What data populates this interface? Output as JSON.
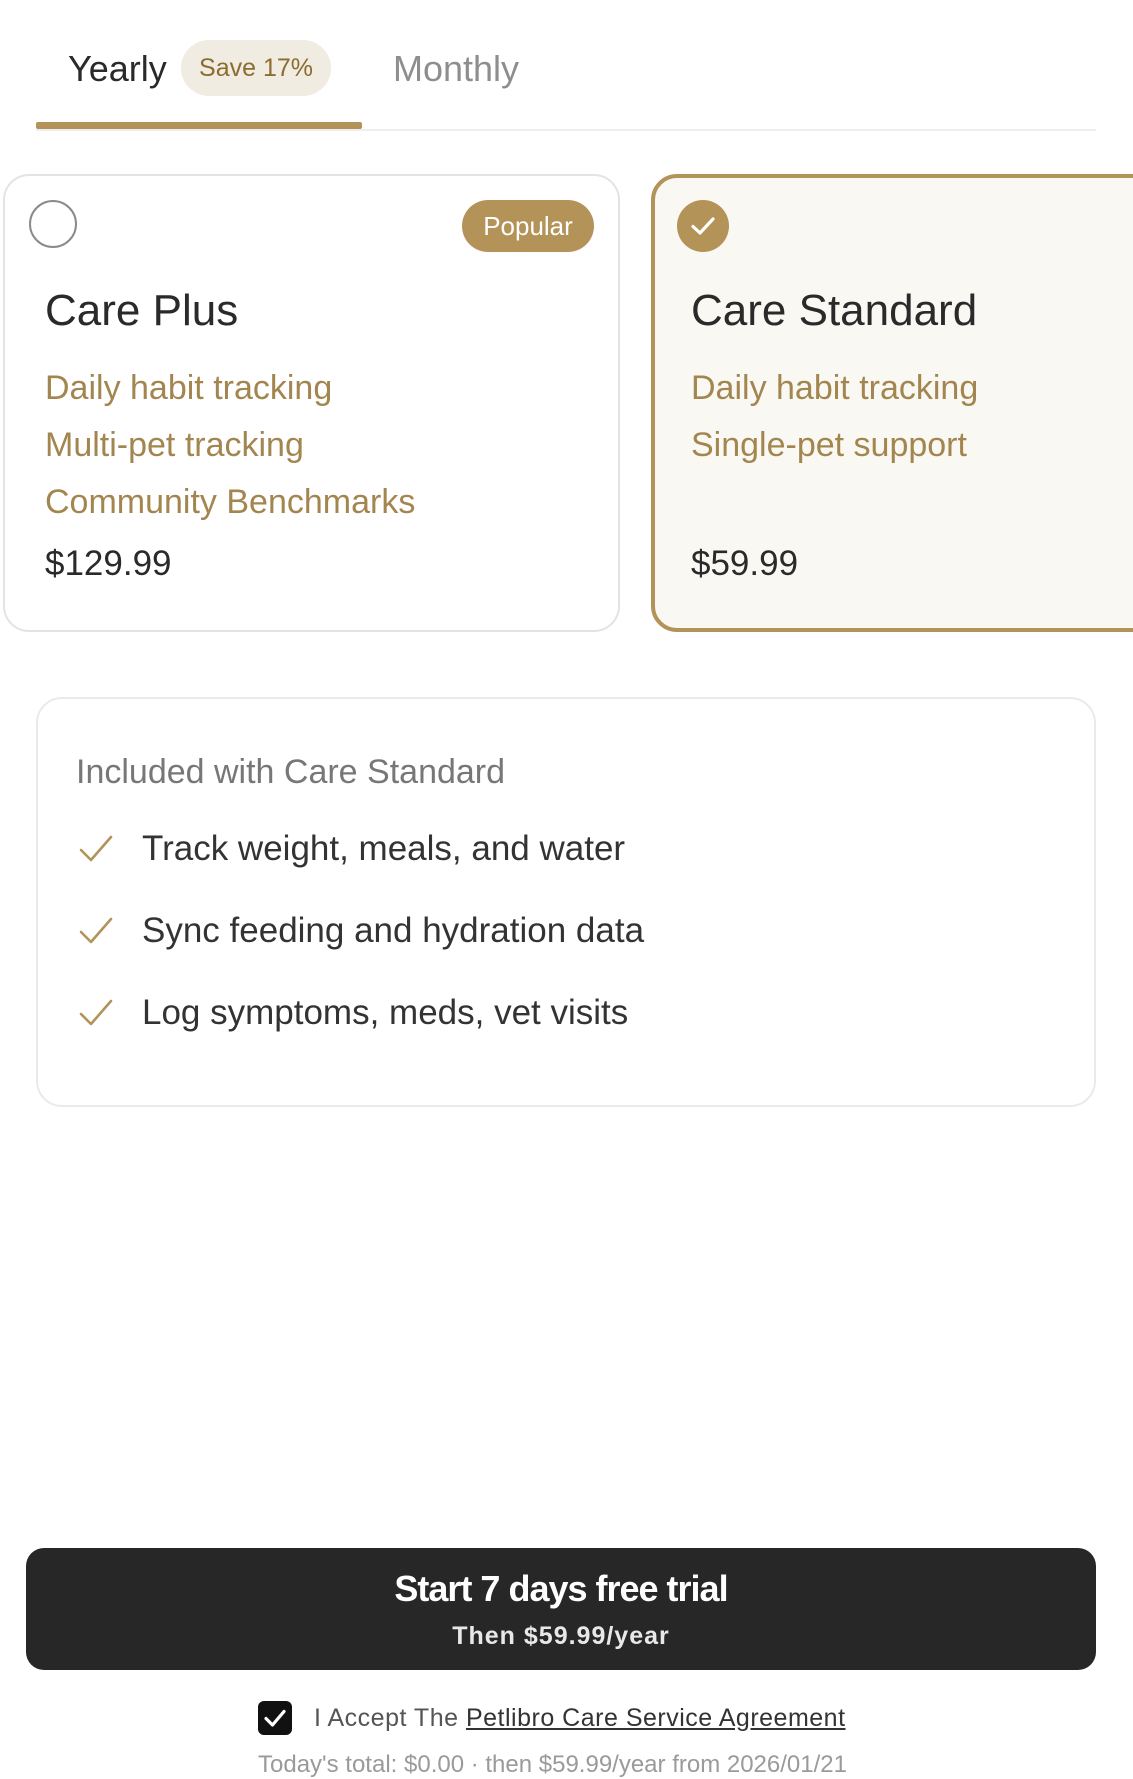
{
  "tabs": {
    "yearly_label": "Yearly",
    "save_badge": "Save 17%",
    "monthly_label": "Monthly",
    "selected": "Yearly"
  },
  "plans": [
    {
      "name": "Care Plus",
      "badge": "Popular",
      "features": [
        "Daily habit tracking",
        "Multi-pet tracking",
        "Community Benchmarks"
      ],
      "price": "$129.99",
      "selected": false
    },
    {
      "name": "Care Standard",
      "features": [
        "Daily habit tracking",
        "Single-pet support"
      ],
      "price": "$59.99",
      "selected": true
    }
  ],
  "included": {
    "title": "Included with Care Standard",
    "items": [
      "Track weight, meals, and water",
      "Sync feeding and hydration data",
      "Log symptoms, meds, vet visits"
    ]
  },
  "cta": {
    "main": "Start 7 days free trial",
    "sub": "Then $59.99/year"
  },
  "agreement": {
    "checked": true,
    "prefix": "I Accept The ",
    "link": "Petlibro Care Service Agreement"
  },
  "fineprint": "Today's total: $0.00 · then $59.99/year from 2026/01/21",
  "colors": {
    "accent": "#b39358",
    "accent_text": "#a3864f",
    "badge_bg": "#f1ece1",
    "selected_card_bg": "#faf8f3",
    "cta_bg": "#272727"
  },
  "icons": {
    "selected_radio": "checkmark-icon",
    "feature_check": "check-icon",
    "agreement_checkbox": "checkbox-checked-icon"
  }
}
